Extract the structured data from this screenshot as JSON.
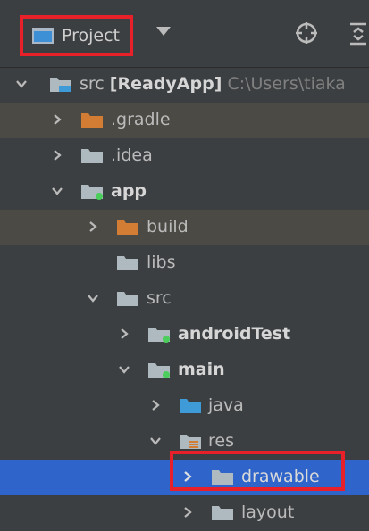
{
  "toolbar": {
    "view_label": "Project",
    "dropdown_icon": "chevron-down-icon",
    "locate_icon": "target-icon",
    "collapse_icon": "collapse-all-icon",
    "highlight_color": "#e8202a"
  },
  "tree": {
    "root": {
      "name": "src",
      "module": "[ReadyApp]",
      "path": "C:\\Users\\tiaka"
    },
    "items": [
      {
        "label": ".gradle",
        "type": "excluded-folder",
        "expanded": false
      },
      {
        "label": ".idea",
        "type": "folder",
        "expanded": false
      },
      {
        "label": "app",
        "type": "module-folder",
        "expanded": true
      },
      {
        "label": "build",
        "type": "excluded-folder",
        "expanded": false
      },
      {
        "label": "libs",
        "type": "folder",
        "expanded": false
      },
      {
        "label": "src",
        "type": "folder",
        "expanded": true
      },
      {
        "label": "androidTest",
        "type": "module-folder",
        "expanded": false
      },
      {
        "label": "main",
        "type": "module-folder",
        "expanded": true
      },
      {
        "label": "java",
        "type": "source-folder",
        "expanded": false
      },
      {
        "label": "res",
        "type": "resource-folder",
        "expanded": true
      },
      {
        "label": "drawable",
        "type": "folder",
        "expanded": false,
        "selected": true
      },
      {
        "label": "layout",
        "type": "folder",
        "expanded": false
      }
    ]
  },
  "colors": {
    "background": "#3c3f41",
    "selection": "#2f65ca",
    "hover_row": "#4c4a44",
    "folder_gray": "#aeb9c0",
    "folder_orange": "#d27c34",
    "folder_blue": "#3f9bd8",
    "module_dot": "#4bce5b"
  }
}
